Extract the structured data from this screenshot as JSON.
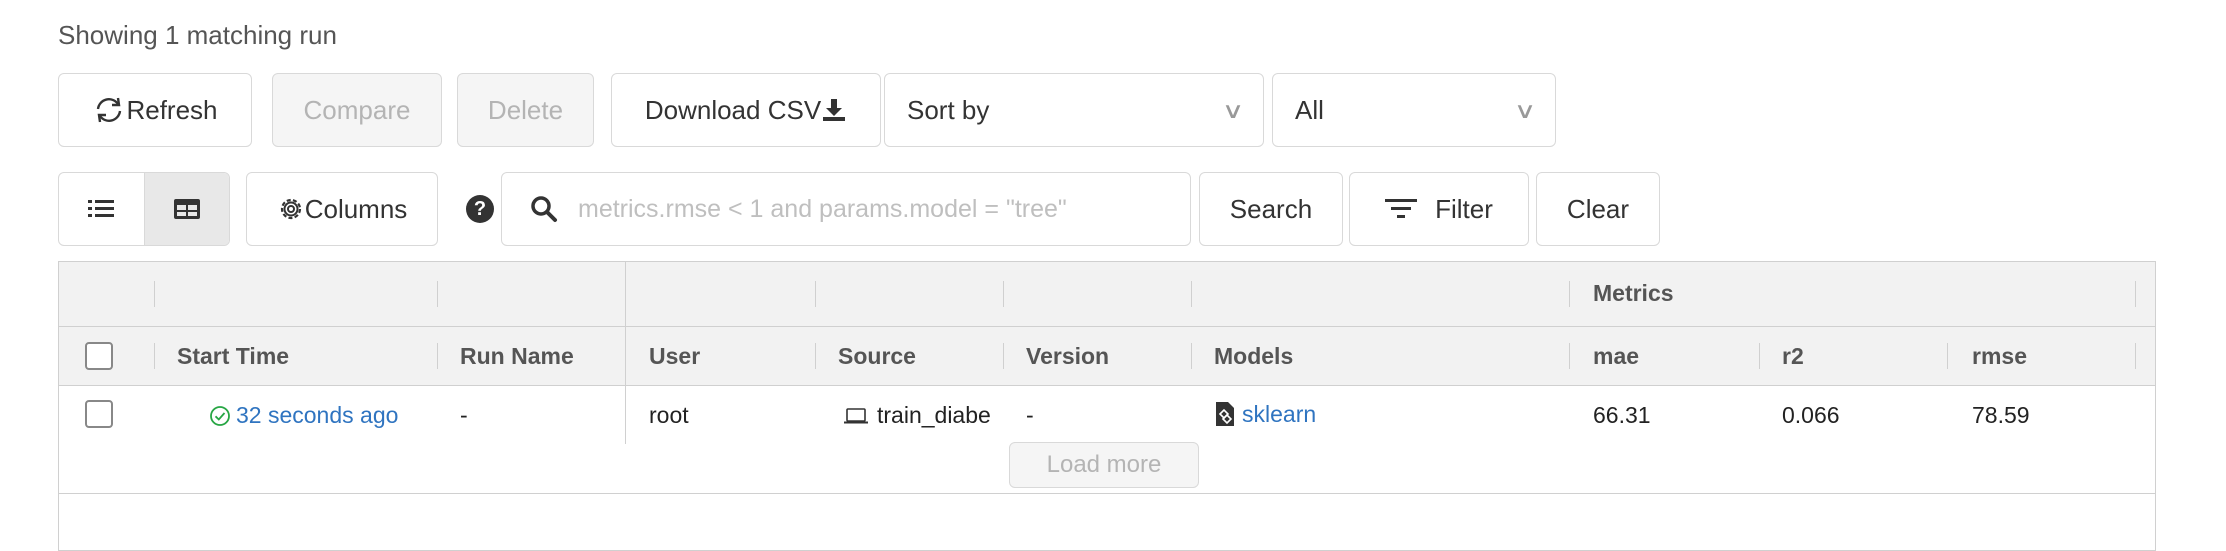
{
  "status": {
    "showing_text": "Showing 1 matching run"
  },
  "toolbar": {
    "refresh_label": "Refresh",
    "compare_label": "Compare",
    "delete_label": "Delete",
    "download_label": "Download CSV",
    "sort_label": "Sort by",
    "filter_select_value": "All"
  },
  "searchbar": {
    "columns_label": "Columns",
    "placeholder": "metrics.rmse < 1 and params.model = \"tree\"",
    "search_label": "Search",
    "filter_label": "Filter",
    "clear_label": "Clear"
  },
  "table": {
    "group_header": "Metrics",
    "columns": [
      "Start Time",
      "Run Name",
      "User",
      "Source",
      "Version",
      "Models",
      "mae",
      "r2",
      "rmse"
    ],
    "rows": [
      {
        "start_time": "32 seconds ago",
        "run_name": "-",
        "user": "root",
        "source": "train_diabe",
        "version": "-",
        "models": "sklearn",
        "mae": "66.31",
        "r2": "0.066",
        "rmse": "78.59"
      }
    ],
    "load_more_label": "Load more"
  },
  "colors": {
    "link": "#2f74c0",
    "success": "#27a644",
    "header_bg": "#f2f2f2",
    "disabled_text": "#b4b4b4"
  },
  "icons": [
    "refresh-icon",
    "download-icon",
    "chevron-down-icon",
    "list-view-icon",
    "grid-view-icon",
    "gear-icon",
    "help-icon",
    "search-icon",
    "filter-icon",
    "check-circle-icon",
    "laptop-icon",
    "model-file-icon"
  ]
}
